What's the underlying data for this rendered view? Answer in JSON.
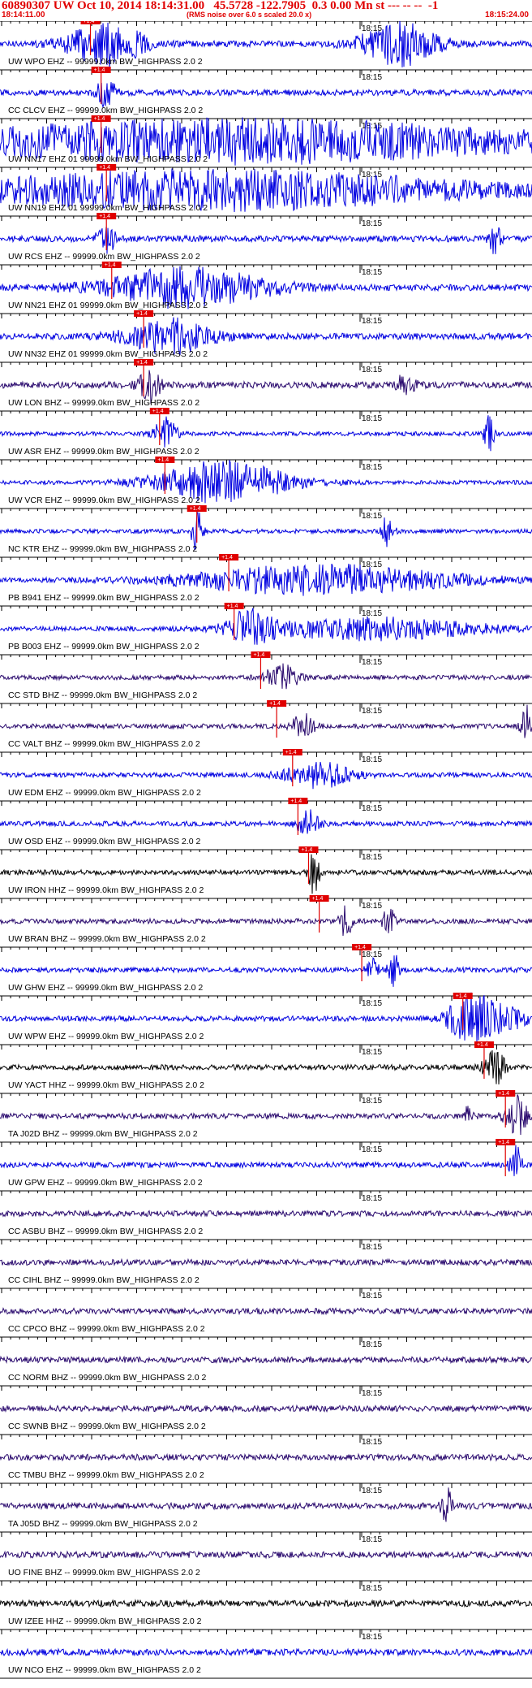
{
  "header": {
    "title": "60890307 UW Oct 10, 2014 18:14:31.00   45.5728 -122.7905  0.3 0.00 Mn st --- -- --  -1",
    "subtitle": "(RMS noise over 6.0 s scaled 20.0 x)",
    "start_time": "18:14:11.00",
    "end_time": "18:15:24.00"
  },
  "colors": {
    "header_text": "#e00000",
    "pick": "#e00000",
    "blue_trace": "#0000e0",
    "purple_trace": "#2a0a6e",
    "black_trace": "#000000"
  },
  "chart_data": {
    "type": "line",
    "title": "60890307 UW Oct 10, 2014 18:14:31.00   45.5728 -122.7905  0.3 0.00 Mn st --- -- --  -1",
    "subtitle": "(RMS noise over 6.0 s scaled 20.0 x)",
    "x_range": [
      "18:14:11.00",
      "18:15:24.00"
    ],
    "minute_label": "18:15",
    "pick_label": "+1.4",
    "traces": [
      {
        "label": "UW WPO EHZ -- 99999.0km BW_HIGHPASS  2.0  2",
        "color": "blue",
        "pick_frac": 0.17,
        "event": [
          [
            0.2,
            0.07,
            1.0
          ],
          [
            0.75,
            0.07,
            1.0
          ]
        ]
      },
      {
        "label": "CC CLCV EHZ -- 99999.0km BW_HIGHPASS  2.0  2",
        "color": "blue",
        "pick_frac": 0.19,
        "event": [
          [
            0.2,
            0.02,
            0.6
          ]
        ]
      },
      {
        "label": "UW NN17 EHZ 01 99999.0km BW_HIGHPASS  2.0  2",
        "color": "blue",
        "pick_frac": 0.19,
        "event": [
          [
            0.45,
            0.6,
            1.0
          ]
        ]
      },
      {
        "label": "UW NN19 EHZ 01 99999.0km BW_HIGHPASS  2.0  2",
        "color": "blue",
        "pick_frac": 0.2,
        "event": [
          [
            0.4,
            0.5,
            0.9
          ]
        ]
      },
      {
        "label": "UW RCS EHZ -- 99999.0km BW_HIGHPASS  2.0  2",
        "color": "blue",
        "pick_frac": 0.2,
        "event": [
          [
            0.2,
            0.02,
            0.6
          ],
          [
            0.93,
            0.01,
            0.7
          ]
        ]
      },
      {
        "label": "UW NN21 EHZ 01 99999.0km BW_HIGHPASS  2.0  2",
        "color": "blue",
        "pick_frac": 0.21,
        "event": [
          [
            0.35,
            0.15,
            0.9
          ]
        ]
      },
      {
        "label": "UW NN32 EHZ 01 99999.0km BW_HIGHPASS  2.0  2",
        "color": "blue",
        "pick_frac": 0.27,
        "event": [
          [
            0.32,
            0.08,
            0.8
          ]
        ]
      },
      {
        "label": "UW LON BHZ -- 99999.0km BW_HIGHPASS  2.0  2",
        "color": "purple",
        "pick_frac": 0.27,
        "event": [
          [
            0.28,
            0.02,
            0.8
          ],
          [
            0.76,
            0.02,
            0.4
          ]
        ]
      },
      {
        "label": "UW ASR EHZ -- 99999.0km BW_HIGHPASS  2.0  2",
        "color": "blue",
        "pick_frac": 0.3,
        "event": [
          [
            0.31,
            0.02,
            0.8
          ],
          [
            0.92,
            0.01,
            0.9
          ]
        ]
      },
      {
        "label": "UW VCR EHZ -- 99999.0km BW_HIGHPASS  2.0  2",
        "color": "blue",
        "pick_frac": 0.31,
        "event": [
          [
            0.42,
            0.12,
            1.0
          ]
        ]
      },
      {
        "label": "NC KTR EHZ -- 99999.0km BW_HIGHPASS  2.0  2",
        "color": "blue",
        "pick_frac": 0.37,
        "event": [
          [
            0.37,
            0.01,
            1.0
          ],
          [
            0.73,
            0.01,
            1.0
          ]
        ]
      },
      {
        "label": "PB B941 EHZ -- 99999.0km BW_HIGHPASS  2.0  2",
        "color": "blue",
        "pick_frac": 0.43,
        "event": [
          [
            0.6,
            0.25,
            0.7
          ]
        ]
      },
      {
        "label": "PB B003 EHZ -- 99999.0km BW_HIGHPASS  2.0  2",
        "color": "blue",
        "pick_frac": 0.44,
        "event": [
          [
            0.47,
            0.04,
            0.8
          ],
          [
            0.7,
            0.2,
            0.5
          ]
        ]
      },
      {
        "label": "CC STD BHZ -- 99999.0km BW_HIGHPASS  2.0  2",
        "color": "purple",
        "pick_frac": 0.49,
        "event": [
          [
            0.53,
            0.03,
            0.6
          ]
        ]
      },
      {
        "label": "CC VALT BHZ -- 99999.0km BW_HIGHPASS  2.0  2",
        "color": "purple",
        "pick_frac": 0.52,
        "event": [
          [
            0.57,
            0.02,
            0.6
          ],
          [
            0.99,
            0.01,
            1.0
          ]
        ]
      },
      {
        "label": "UW EDM EHZ -- 99999.0km BW_HIGHPASS  2.0  2",
        "color": "blue",
        "pick_frac": 0.55,
        "event": [
          [
            0.6,
            0.06,
            0.6
          ]
        ]
      },
      {
        "label": "UW OSD EHZ -- 99999.0km BW_HIGHPASS  2.0  2",
        "color": "blue",
        "pick_frac": 0.56,
        "event": [
          [
            0.58,
            0.02,
            0.6
          ]
        ]
      },
      {
        "label": "UW IRON HHZ -- 99999.0km BW_HIGHPASS  2.0  2",
        "color": "black",
        "pick_frac": 0.58,
        "event": [
          [
            0.59,
            0.01,
            1.0
          ]
        ]
      },
      {
        "label": "UW BRAN BHZ -- 99999.0km BW_HIGHPASS  2.0  2",
        "color": "purple",
        "pick_frac": 0.6,
        "event": [
          [
            0.65,
            0.01,
            1.0
          ],
          [
            0.73,
            0.01,
            0.8
          ]
        ]
      },
      {
        "label": "UW GHW EHZ -- 99999.0km BW_HIGHPASS  2.0  2",
        "color": "blue",
        "pick_frac": 0.68,
        "event": [
          [
            0.7,
            0.01,
            0.8
          ],
          [
            0.74,
            0.01,
            0.8
          ]
        ]
      },
      {
        "label": "UW WPW EHZ -- 99999.0km BW_HIGHPASS  2.0  2",
        "color": "blue",
        "pick_frac": 0.87,
        "event": [
          [
            0.88,
            0.04,
            1.0
          ],
          [
            0.94,
            0.05,
            0.6
          ]
        ]
      },
      {
        "label": "UW YACT HHZ -- 99999.0km BW_HIGHPASS  2.0  2",
        "color": "black",
        "pick_frac": 0.91,
        "event": [
          [
            0.93,
            0.02,
            0.8
          ]
        ]
      },
      {
        "label": "TA J02D BHZ -- 99999.0km BW_HIGHPASS  2.0  2",
        "color": "purple",
        "pick_frac": 0.95,
        "event": [
          [
            0.97,
            0.02,
            1.0
          ],
          [
            0.88,
            0.01,
            0.4
          ]
        ]
      },
      {
        "label": "UW GPW EHZ -- 99999.0km BW_HIGHPASS  2.0  2",
        "color": "blue",
        "pick_frac": 0.95,
        "event": [
          [
            0.97,
            0.01,
            1.0
          ]
        ]
      },
      {
        "label": "CC ASBU BHZ -- 99999.0km BW_HIGHPASS  2.0  2",
        "color": "purple",
        "event": []
      },
      {
        "label": "CC CIHL BHZ -- 99999.0km BW_HIGHPASS  2.0  2",
        "color": "purple",
        "event": []
      },
      {
        "label": "CC CPCO BHZ -- 99999.0km BW_HIGHPASS  2.0  2",
        "color": "purple",
        "event": []
      },
      {
        "label": "CC NORM BHZ -- 99999.0km BW_HIGHPASS  2.0  2",
        "color": "purple",
        "event": []
      },
      {
        "label": "CC SWNB BHZ -- 99999.0km BW_HIGHPASS  2.0  2",
        "color": "purple",
        "event": []
      },
      {
        "label": "CC TMBU BHZ -- 99999.0km BW_HIGHPASS  2.0  2",
        "color": "purple",
        "event": []
      },
      {
        "label": "TA J05D BHZ -- 99999.0km BW_HIGHPASS  2.0  2",
        "color": "purple",
        "event": [
          [
            0.84,
            0.01,
            0.8
          ]
        ]
      },
      {
        "label": "UO FINE BHZ -- 99999.0km BW_HIGHPASS  2.0  2",
        "color": "purple",
        "event": []
      },
      {
        "label": "UW IZEE HHZ -- 99999.0km BW_HIGHPASS  2.0  2",
        "color": "black",
        "event": []
      },
      {
        "label": "UW NCO EHZ -- 99999.0km BW_HIGHPASS  2.0  2",
        "color": "blue",
        "event": []
      }
    ]
  }
}
